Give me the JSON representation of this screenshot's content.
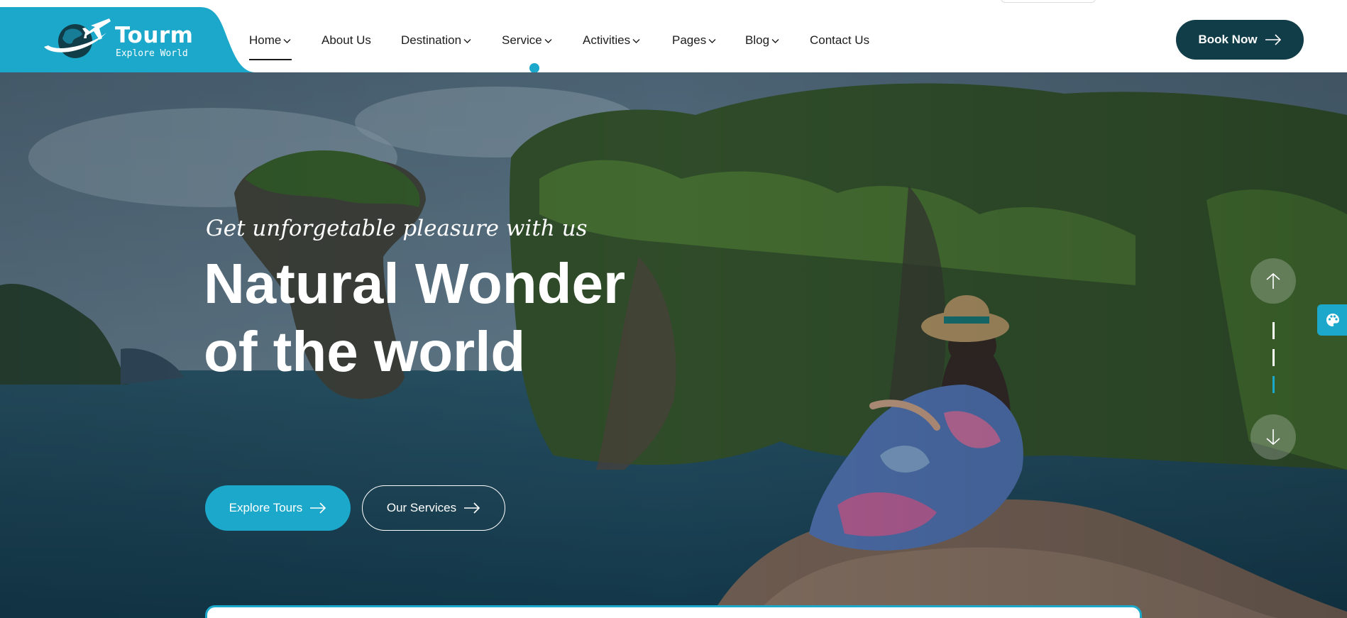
{
  "brand": {
    "name": "Tourm",
    "tagline": "Explore World",
    "accent_color": "#1ca8cb",
    "dark_color": "#113d48"
  },
  "nav": {
    "items": [
      {
        "label": "Home",
        "has_dropdown": true,
        "active": true
      },
      {
        "label": "About Us",
        "has_dropdown": false
      },
      {
        "label": "Destination",
        "has_dropdown": true
      },
      {
        "label": "Service",
        "has_dropdown": true
      },
      {
        "label": "Activities",
        "has_dropdown": true
      },
      {
        "label": "Pages",
        "has_dropdown": true
      },
      {
        "label": "Blog",
        "has_dropdown": true
      },
      {
        "label": "Contact Us",
        "has_dropdown": false
      }
    ],
    "cta_label": "Book Now"
  },
  "hero": {
    "subtitle": "Get unforgetable pleasure with us",
    "title_line1": "Natural Wonder",
    "title_line2": "of the world",
    "primary_button": "Explore Tours",
    "secondary_button": "Our Services"
  },
  "slider": {
    "total_slides": 3,
    "active_slide": 3
  },
  "icons": [
    "globe-plane-logo-icon",
    "chevron-down-icon",
    "arrow-right-icon",
    "arrow-up-icon",
    "arrow-down-icon",
    "palette-icon"
  ]
}
